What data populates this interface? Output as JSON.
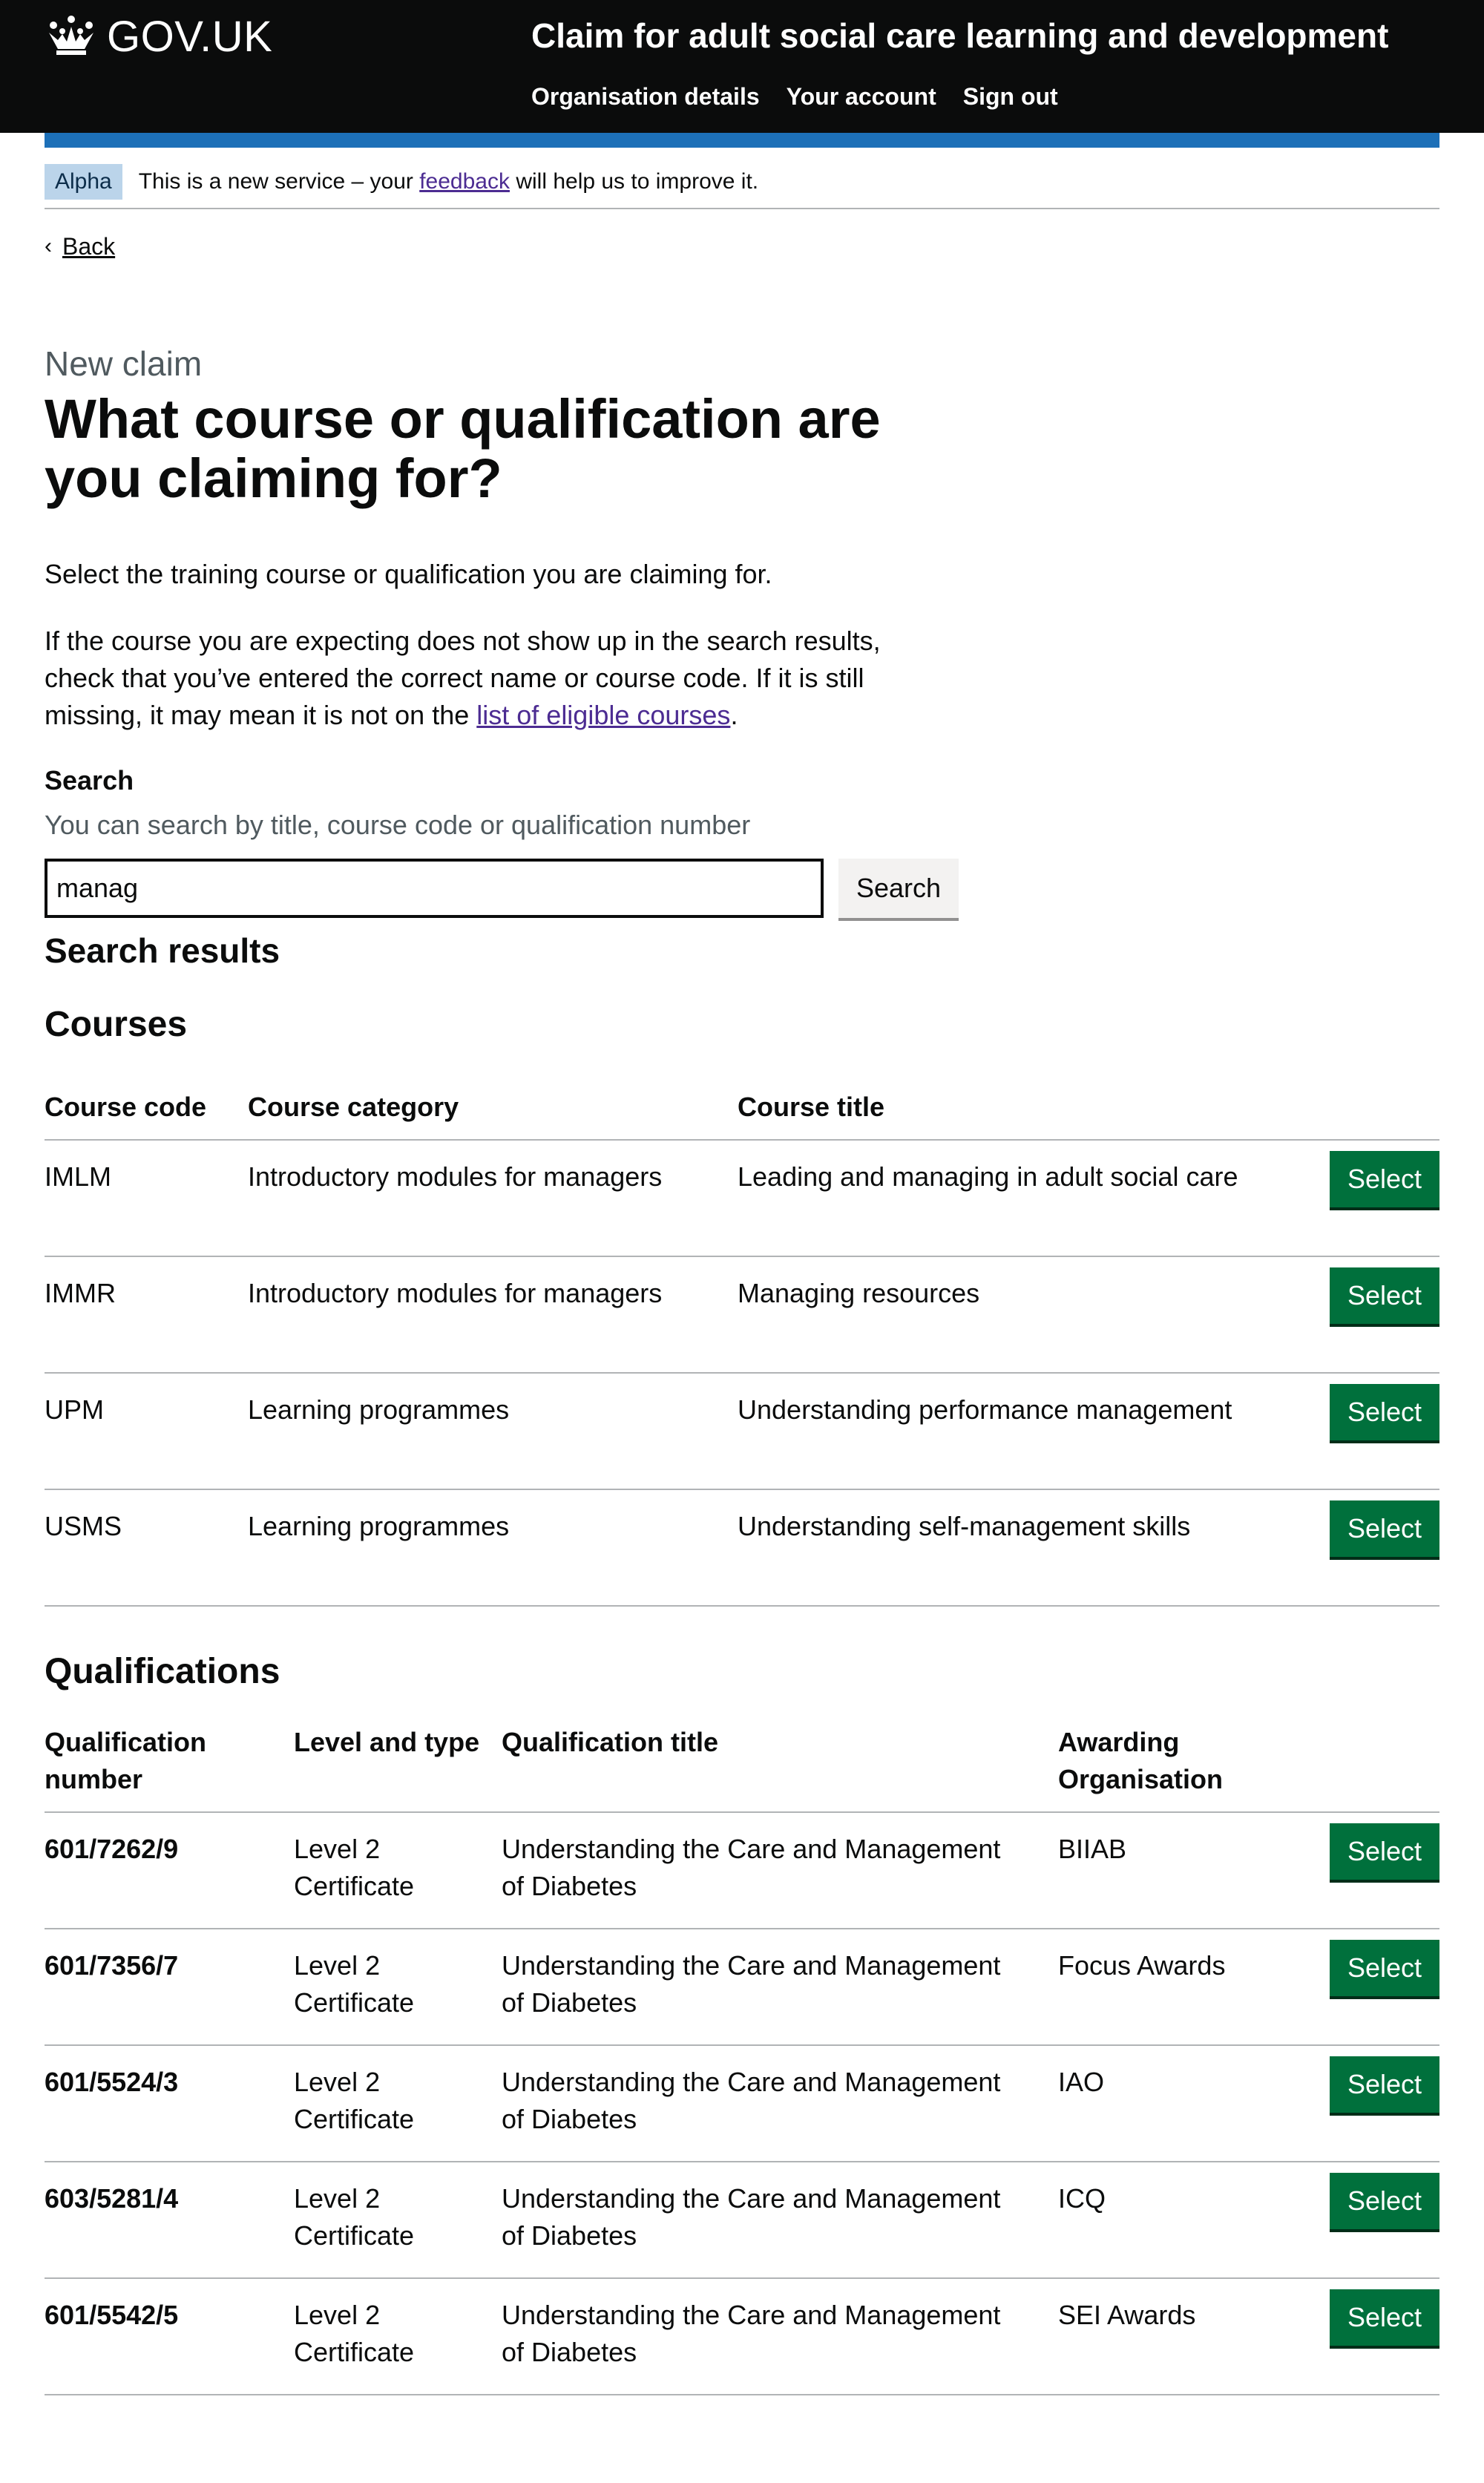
{
  "header": {
    "logo_text": "GOV.UK",
    "service_name": "Claim for adult social care learning and development",
    "nav": [
      "Organisation details",
      "Your account",
      "Sign out"
    ]
  },
  "phase_banner": {
    "tag": "Alpha",
    "text_before": "This is a new service – your",
    "link": "feedback",
    "text_after": "will help us to improve it."
  },
  "back_link": "Back",
  "page": {
    "caption": "New claim",
    "title": "What course or qualification are you claiming for?",
    "intro": "Select the training course or qualification you are claiming for.",
    "info_before": "If the course you are expecting does not show up in the search results, check that you’ve entered the correct name or course code. If it is still missing, it may mean it is not on the",
    "info_link": "list of eligible courses",
    "info_after": "."
  },
  "search": {
    "label": "Search",
    "hint": "You can search by title, course code or qualification number",
    "value": "manag",
    "button": "Search"
  },
  "results_heading": "Search results",
  "courses": {
    "heading": "Courses",
    "headers": [
      "Course code",
      "Course category",
      "Course title"
    ],
    "select_label": "Select",
    "rows": [
      {
        "code": "IMLM",
        "category": "Introductory modules for managers",
        "title": "Leading and managing in adult social care"
      },
      {
        "code": "IMMR",
        "category": "Introductory modules for managers",
        "title": "Managing resources"
      },
      {
        "code": "UPM",
        "category": "Learning programmes",
        "title": "Understanding performance management"
      },
      {
        "code": "USMS",
        "category": "Learning programmes",
        "title": "Understanding self-management skills"
      }
    ]
  },
  "qualifications": {
    "heading": "Qualifications",
    "headers": [
      "Qualification number",
      "Level and type",
      "Qualification title",
      "Awarding Organisation"
    ],
    "select_label": "Select",
    "rows": [
      {
        "number": "601/7262/9",
        "level": "Level 2 Certificate",
        "title": "Understanding the Care and Management of Diabetes",
        "org": "BIIAB"
      },
      {
        "number": "601/7356/7",
        "level": "Level 2 Certificate",
        "title": "Understanding the Care and Management of Diabetes",
        "org": "Focus Awards"
      },
      {
        "number": "601/5524/3",
        "level": "Level 2 Certificate",
        "title": "Understanding the Care and Management of Diabetes",
        "org": "IAO"
      },
      {
        "number": "603/5281/4",
        "level": "Level 2 Certificate",
        "title": "Understanding the Care and Management of Diabetes",
        "org": "ICQ"
      },
      {
        "number": "601/5542/5",
        "level": "Level 2 Certificate",
        "title": "Understanding the Care and Management of Diabetes",
        "org": "SEI Awards"
      }
    ]
  },
  "colors": {
    "header_bg": "#0b0c0c",
    "blue_bar": "#1d70b8",
    "link": "#4c2c92",
    "select_button": "#00703c",
    "phase_tag": "#bbd4ea"
  }
}
